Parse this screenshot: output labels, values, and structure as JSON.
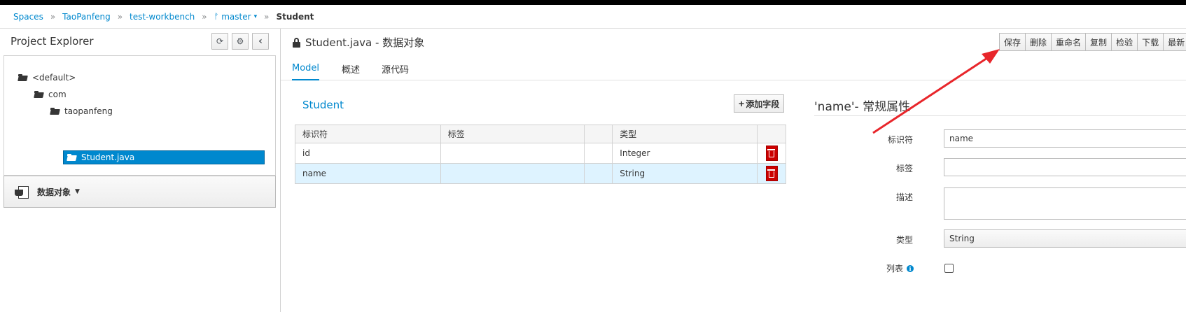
{
  "breadcrumb": {
    "items": [
      "Spaces",
      "TaoPanfeng",
      "test-workbench",
      "master"
    ],
    "separator": "»",
    "current": "Student"
  },
  "project_explorer": {
    "title": "Project Explorer",
    "tree": [
      "<default>",
      "com",
      "taopanfeng",
      "Student.java"
    ],
    "data_object_menu": "数据对象"
  },
  "editor": {
    "title": "Student.java - 数据对象",
    "toolbar": [
      "保存",
      "删除",
      "重命名",
      "复制",
      "检验",
      "下载",
      "最新"
    ],
    "tabs": [
      "Model",
      "概述",
      "源代码"
    ]
  },
  "model": {
    "name": "Student",
    "add_field_label": "添加字段",
    "columns": [
      "标识符",
      "标签",
      "",
      "类型"
    ],
    "rows": [
      {
        "id": "id",
        "label": "",
        "type": "Integer"
      },
      {
        "id": "name",
        "label": "",
        "type": "String"
      }
    ]
  },
  "properties": {
    "title": "'name'- 常规属性",
    "labels": {
      "identifier": "标识符",
      "label": "标签",
      "description": "描述",
      "type": "类型",
      "list": "列表"
    },
    "values": {
      "identifier": "name",
      "label": "",
      "type": "String"
    },
    "list_checked": false
  },
  "colors": {
    "accent": "#0088ce",
    "danger": "#cc0000",
    "annotation": "#e8262b"
  }
}
